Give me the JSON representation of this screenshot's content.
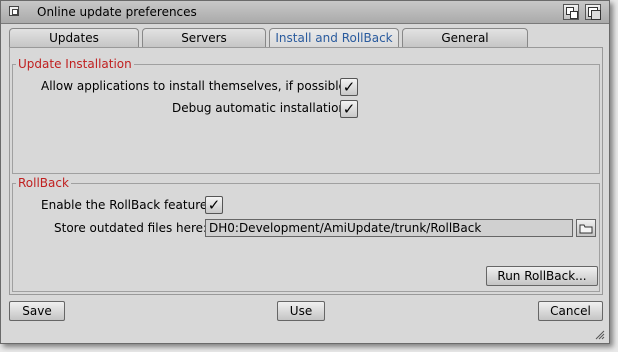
{
  "window": {
    "title": "Online update preferences"
  },
  "tabs": [
    {
      "label": "Updates"
    },
    {
      "label": "Servers"
    },
    {
      "label": "Install and RollBack"
    },
    {
      "label": "General"
    }
  ],
  "update_installation": {
    "title": "Update Installation",
    "allow_label": "Allow applications to install themselves, if possible:",
    "allow_checked": true,
    "debug_label": "Debug automatic installation:",
    "debug_checked": true
  },
  "rollback": {
    "title": "RollBack",
    "enable_label": "Enable the RollBack feature:",
    "enable_checked": true,
    "store_label": "Store outdated files here:",
    "store_path": "DH0:Development/AmiUpdate/trunk/RollBack",
    "run_label": "Run RollBack..."
  },
  "footer": {
    "save": "Save",
    "use": "Use",
    "cancel": "Cancel"
  },
  "glyphs": {
    "check": "✓"
  },
  "colors": {
    "group_title": "#c02020",
    "active_tab": "#2a5b9e"
  }
}
